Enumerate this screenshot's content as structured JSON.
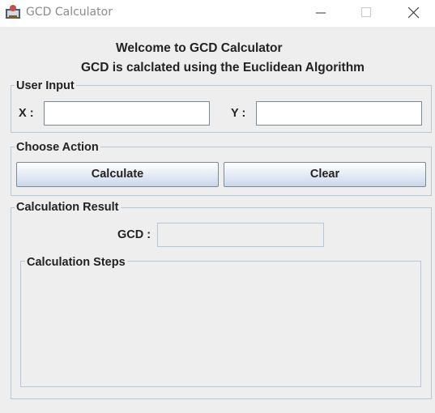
{
  "window": {
    "title": "GCD Calculator",
    "app_icon": "app-icon",
    "controls": [
      "minimize-icon",
      "maximize-icon",
      "close-icon"
    ]
  },
  "header": {
    "welcome": "Welcome to GCD Calculator",
    "subtitle": "GCD is calclated using the Euclidean Algorithm"
  },
  "user_input": {
    "title": "User Input",
    "x_label": "X :",
    "x_value": "",
    "y_label": "Y :",
    "y_value": ""
  },
  "choose_action": {
    "title": "Choose Action",
    "calculate_label": "Calculate",
    "clear_label": "Clear"
  },
  "result": {
    "title": "Calculation Result",
    "gcd_label": "GCD :",
    "gcd_value": "",
    "steps_title": "Calculation Steps",
    "steps_text": ""
  },
  "colors": {
    "background": "#eeeeee",
    "group_border": "#b6c7d9",
    "button_gradient_bottom": "#c9d8ea"
  }
}
